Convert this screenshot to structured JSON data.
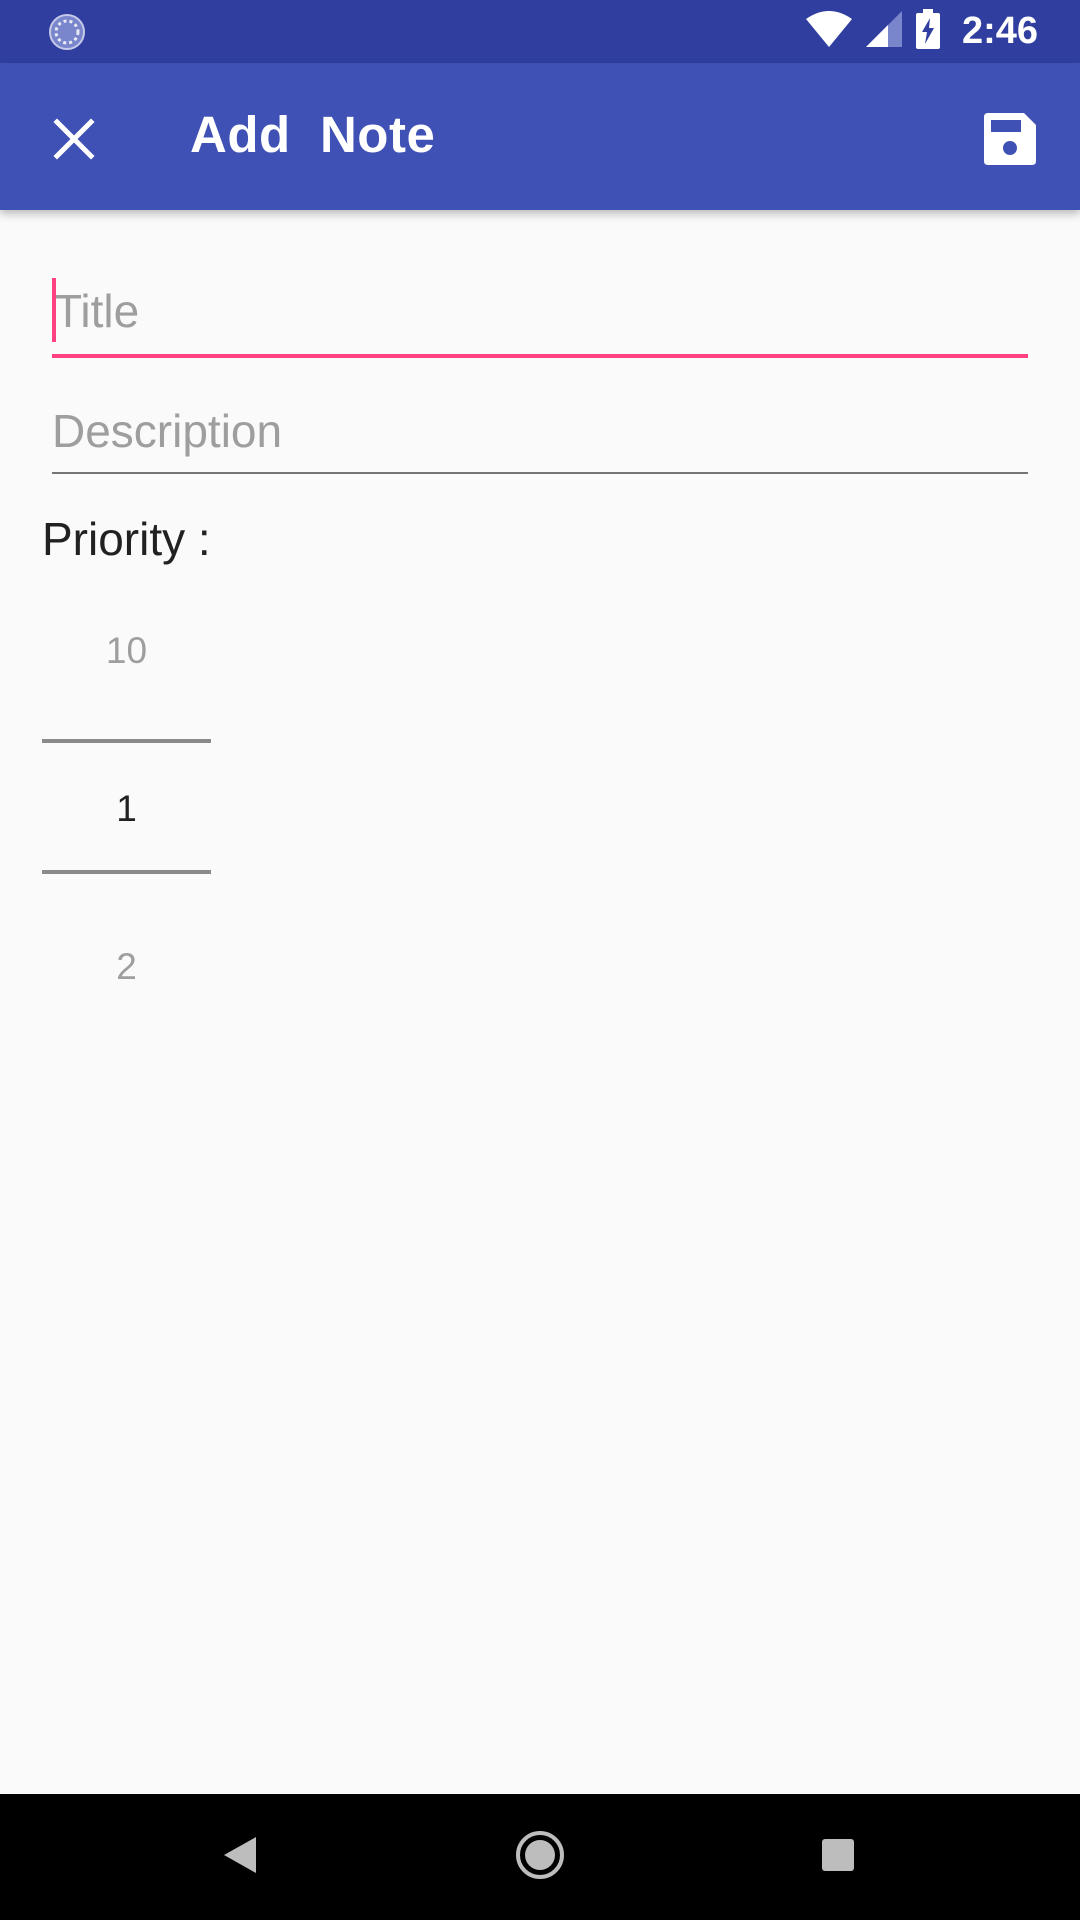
{
  "status_bar": {
    "time": "2:46",
    "icons": [
      "sync-icon",
      "wifi-icon",
      "signal-icon",
      "battery-charging-icon"
    ]
  },
  "app_bar": {
    "title": "Add  Note",
    "close_icon": "close-icon",
    "save_icon": "save-icon",
    "color": "#3f51b5"
  },
  "form": {
    "title_placeholder": "Title",
    "title_value": "",
    "description_placeholder": "Description",
    "description_value": "",
    "priority_label": "Priority :",
    "accent_color": "#ff4081"
  },
  "priority_picker": {
    "previous": "10",
    "selected": "1",
    "next": "2"
  },
  "nav_bar": {
    "icons": [
      "back-icon",
      "home-icon",
      "recents-icon"
    ]
  }
}
